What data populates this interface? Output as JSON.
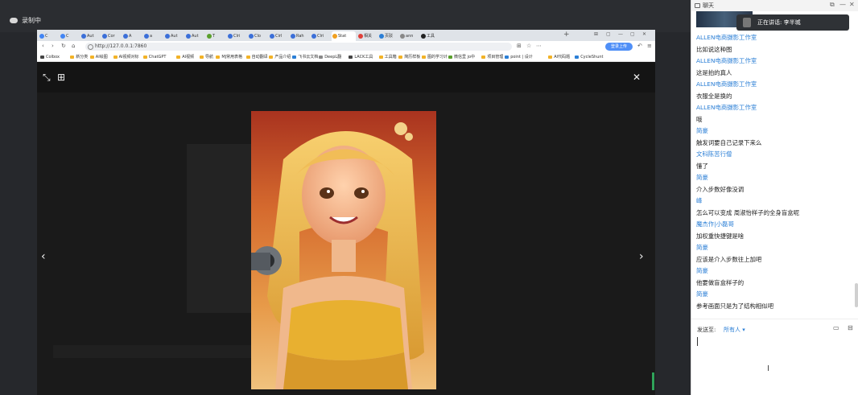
{
  "recording": {
    "label": "录制中"
  },
  "browser": {
    "tabs": [
      {
        "label": "C",
        "color": "#4285f4"
      },
      {
        "label": "C",
        "color": "#4285f4"
      },
      {
        "label": "Aut",
        "color": "#3b6fd8"
      },
      {
        "label": "Cor",
        "color": "#3b6fd8"
      },
      {
        "label": "A",
        "color": "#3b6fd8"
      },
      {
        "label": "a",
        "color": "#3b6fd8"
      },
      {
        "label": "Aut",
        "color": "#3b6fd8"
      },
      {
        "label": "Aut",
        "color": "#3b6fd8"
      },
      {
        "label": "T",
        "color": "#5aa02c"
      },
      {
        "label": "Clri",
        "color": "#3b6fd8"
      },
      {
        "label": "Clo",
        "color": "#3b6fd8"
      },
      {
        "label": "Cirl",
        "color": "#3b6fd8"
      },
      {
        "label": "Rah",
        "color": "#3b6fd8"
      },
      {
        "label": "Clri",
        "color": "#3b6fd8"
      },
      {
        "label": "Stat",
        "color": "#f0a020",
        "active": true
      },
      {
        "label": "相关",
        "color": "#e0403a"
      },
      {
        "label": "页驳",
        "color": "#2b7fd6"
      },
      {
        "label": "ann",
        "color": "#888888"
      },
      {
        "label": "工具",
        "color": "#222222"
      }
    ],
    "new_tab": "+",
    "window_controls": [
      "⊞",
      "▢",
      "—",
      "▢",
      "✕"
    ],
    "url": "http://127.0.0.1:7860",
    "login_button": "登录上传",
    "bookmarks": [
      {
        "label": "Colbox",
        "color": "#444"
      },
      {
        "label": "新分类",
        "color": "#f2b227"
      },
      {
        "label": "AI绘图",
        "color": "#f2b227"
      },
      {
        "label": "AI视频对标",
        "color": "#f2b227"
      },
      {
        "label": "ChatGPT",
        "color": "#f2b227"
      },
      {
        "label": "AI视频",
        "color": "#f2b227"
      },
      {
        "label": "导航",
        "color": "#f2b227"
      },
      {
        "label": "MJ常用表格",
        "color": "#f2b227"
      },
      {
        "label": "自动翻译",
        "color": "#f2b227"
      },
      {
        "label": "产品介绍",
        "color": "#f2b227"
      },
      {
        "label": "飞书云文档",
        "color": "#2b7fd6"
      },
      {
        "label": "DeepL翻",
        "color": "#888888"
      },
      {
        "label": "LACK工具",
        "color": "#444444"
      },
      {
        "label": "工具箱",
        "color": "#f2b227"
      },
      {
        "label": "简历样板",
        "color": "#f2b227"
      },
      {
        "label": "图的学习计",
        "color": "#f2b227"
      },
      {
        "label": "微信里 jo中",
        "color": "#5aa02c"
      },
      {
        "label": "项目管理",
        "color": "#f2b227"
      },
      {
        "label": "point | 设计",
        "color": "#2b7fd6"
      },
      {
        "label": "AI代码题",
        "color": "#f2b227"
      },
      {
        "label": "CycleShunt",
        "color": "#2b7fd6"
      }
    ]
  },
  "viewer": {
    "controls": {
      "fullscreen": "⤡",
      "grid": "⊞",
      "close": "✕",
      "prev": "‹",
      "next": "›"
    }
  },
  "chat": {
    "title": "聊天",
    "speaking": "正在讲话: 李半城",
    "messages": [
      {
        "type": "name",
        "text": "ALLEN电商摄影工作室"
      },
      {
        "type": "text",
        "text": "比如说这种图"
      },
      {
        "type": "name",
        "text": "ALLEN电商摄影工作室"
      },
      {
        "type": "text",
        "text": "这是拍的真人"
      },
      {
        "type": "name",
        "text": "ALLEN电商摄影工作室"
      },
      {
        "type": "text",
        "text": "衣服全是换的"
      },
      {
        "type": "name",
        "text": "ALLEN电商摄影工作室"
      },
      {
        "type": "text",
        "text": "哦"
      },
      {
        "type": "name",
        "text": "简豪"
      },
      {
        "type": "text",
        "text": "触发词要自己记录下来么"
      },
      {
        "type": "name",
        "text": "文科陈苦行僧"
      },
      {
        "type": "text",
        "text": "懂了"
      },
      {
        "type": "name",
        "text": "简豪"
      },
      {
        "type": "text",
        "text": "介入步数好像没调"
      },
      {
        "type": "name",
        "text": "峰"
      },
      {
        "type": "text",
        "text": "怎么可以变成 周淑怡样子的全身盲盒呢"
      },
      {
        "type": "name",
        "text": "魔杰作|小磊哥"
      },
      {
        "type": "text",
        "text": "加权重快捷键是啥"
      },
      {
        "type": "name",
        "text": "简豪"
      },
      {
        "type": "text",
        "text": "应该是介入步数往上加吧"
      },
      {
        "type": "name",
        "text": "简豪"
      },
      {
        "type": "text",
        "text": "他要做盲盒样子的"
      },
      {
        "type": "name",
        "text": "简豪"
      },
      {
        "type": "text",
        "text": "参考画面只是为了结构相似吧"
      }
    ],
    "composer": {
      "send_to_label": "发送至:",
      "send_to_value": "所有人 ▾",
      "input_value": ""
    }
  }
}
